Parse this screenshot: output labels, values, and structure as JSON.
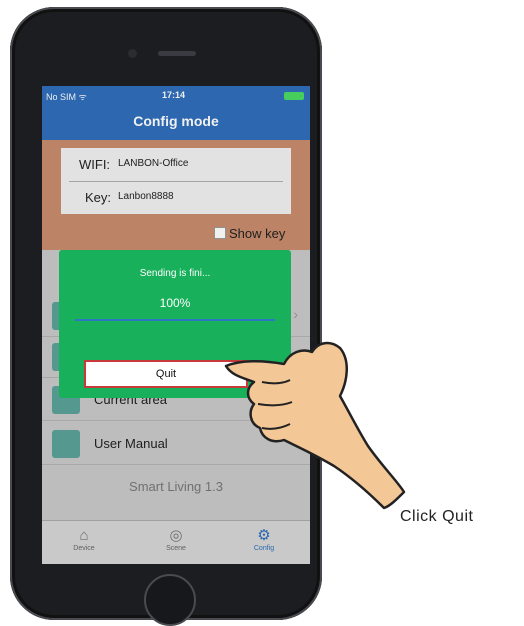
{
  "status_bar": {
    "carrier": "No SIM ᯤ",
    "time": "17:14"
  },
  "nav": {
    "title": "Config mode"
  },
  "form": {
    "wifi_label": "WIFI:",
    "wifi_value": "LANBON-Office",
    "key_label": "Key:",
    "key_value": "Lanbon8888",
    "show_key": "Show key"
  },
  "list": [
    {
      "label": "",
      "icon": "device-icon"
    },
    {
      "label": "",
      "icon": "scene-icon"
    },
    {
      "label": "Current area",
      "icon": "area-icon"
    },
    {
      "label": "User Manual",
      "icon": "book-icon"
    }
  ],
  "version": "Smart Living 1.3",
  "tabs": [
    {
      "label": "Device",
      "icon": "home-icon"
    },
    {
      "label": "Scene",
      "icon": "scene-icon"
    },
    {
      "label": "Config",
      "icon": "gear-icon"
    }
  ],
  "dialog": {
    "message": "Sending is fini...",
    "percent": "100%",
    "progress": 1.0,
    "quit_label": "Quit"
  },
  "caption": "Click Quit",
  "colors": {
    "nav_blue": "#2f6ebb",
    "dialog_green": "#18b05b",
    "highlight_red": "#c83a3a"
  }
}
